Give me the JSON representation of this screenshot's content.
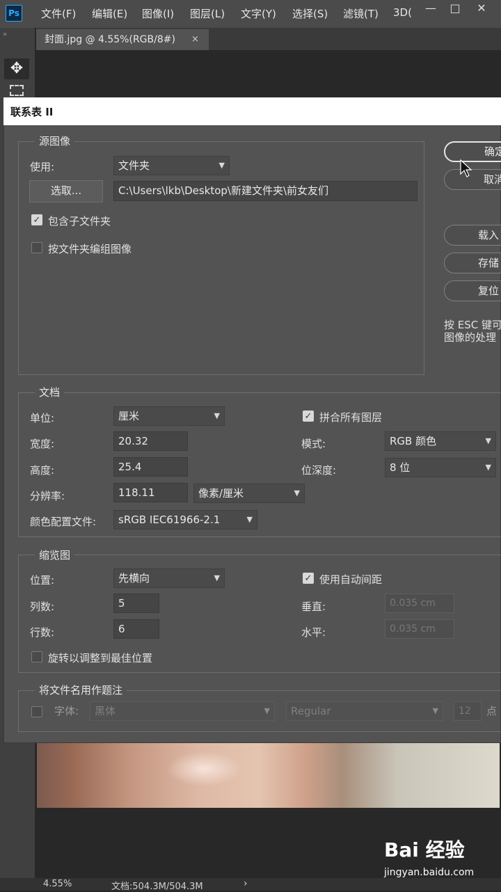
{
  "app": {
    "logo": "Ps",
    "menu": [
      "文件(F)",
      "编辑(E)",
      "图像(I)",
      "图层(L)",
      "文字(Y)",
      "选择(S)",
      "滤镜(T)",
      "3D("
    ],
    "window_controls": [
      "minimize-icon",
      "maximize-icon",
      "close-icon"
    ]
  },
  "document_tab": {
    "title": "封面.jpg @ 4.55%(RGB/8#)",
    "close": "×"
  },
  "toolbar": {
    "grip": "»",
    "tools": [
      "move-tool-icon",
      "marquee-tool-icon"
    ]
  },
  "dialog": {
    "title": "联系表 II",
    "source": {
      "title": "源图像",
      "use_label": "使用:",
      "use_value": "文件夹",
      "choose_button": "选取...",
      "path": "C:\\Users\\lkb\\Desktop\\新建文件夹\\前女友们",
      "include_subfolders": {
        "label": "包含子文件夹",
        "checked": true
      },
      "group_by_folder": {
        "label": "按文件夹编组图像",
        "checked": false
      }
    },
    "document": {
      "title": "文档",
      "unit_label": "单位:",
      "unit_value": "厘米",
      "width_label": "宽度:",
      "width_value": "20.32",
      "height_label": "高度:",
      "height_value": "25.4",
      "resolution_label": "分辨率:",
      "resolution_value": "118.11",
      "resolution_unit": "像素/厘米",
      "color_profile_label": "颜色配置文件:",
      "color_profile_value": "sRGB IEC61966-2.1",
      "flatten": {
        "label": "拼合所有图层",
        "checked": true
      },
      "mode_label": "模式:",
      "mode_value": "RGB 颜色",
      "bit_depth_label": "位深度:",
      "bit_depth_value": "8 位"
    },
    "thumbnails": {
      "title": "缩览图",
      "place_label": "位置:",
      "place_value": "先横向",
      "columns_label": "列数:",
      "columns_value": "5",
      "rows_label": "行数:",
      "rows_value": "6",
      "rotate": {
        "label": "旋转以调整到最佳位置",
        "checked": false
      },
      "auto_spacing": {
        "label": "使用自动间距",
        "checked": true
      },
      "vertical_label": "垂直:",
      "vertical_value": "0.035 cm",
      "horizontal_label": "水平:",
      "horizontal_value": "0.035 cm"
    },
    "filename_caption": {
      "title": "将文件名用作题注",
      "checked": false,
      "font_label": "字体:",
      "font_value": "黑体",
      "style_value": "Regular",
      "size_value": "12",
      "size_unit": "点"
    },
    "buttons": {
      "ok": "确定",
      "cancel": "取消",
      "load": "载入",
      "save": "存储",
      "reset": "复位"
    },
    "hint": [
      "按 ESC 键可",
      "图像的处理"
    ]
  },
  "status": {
    "zoom": "4.55%",
    "doc_info": "文档:504.3M/504.3M",
    "arrow": "›"
  },
  "watermark": {
    "brand": "Bai 经验",
    "url": "jingyan.baidu.com"
  }
}
